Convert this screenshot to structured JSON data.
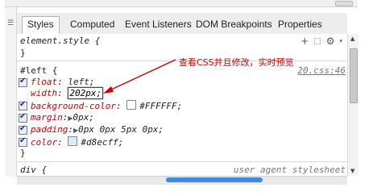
{
  "tabs": [
    {
      "label": "Styles",
      "active": true
    },
    {
      "label": "Computed",
      "active": false
    },
    {
      "label": "Event Listeners",
      "active": false
    },
    {
      "label": "DOM Breakpoints",
      "active": false
    },
    {
      "label": "Properties",
      "active": false
    }
  ],
  "element_style": {
    "selector": "element.style {",
    "close": "}"
  },
  "left_rule": {
    "selector": "#left {",
    "source": "20.css:46",
    "close": "}",
    "props": [
      {
        "name": "float",
        "value": "left;"
      },
      {
        "name": "width",
        "value_edit": "202",
        "value_rest": "px;"
      },
      {
        "name": "background-color",
        "value": "#FFFFFF;",
        "color": "#FFFFFF"
      },
      {
        "name": "margin",
        "value": "0px;"
      },
      {
        "name": "padding",
        "value": "0px 0px 5px 0px;"
      },
      {
        "name": "color",
        "value": "#d8ecff;",
        "color": "#d8ecff"
      }
    ]
  },
  "div_rule": {
    "selector": "div {",
    "source": "user agent stylesheet"
  },
  "annotation": "查看CSS并且修改，实时预览",
  "icons": {
    "new_rule": "plus-icon",
    "element_state": "element-state-icon",
    "settings": "gear-icon"
  }
}
